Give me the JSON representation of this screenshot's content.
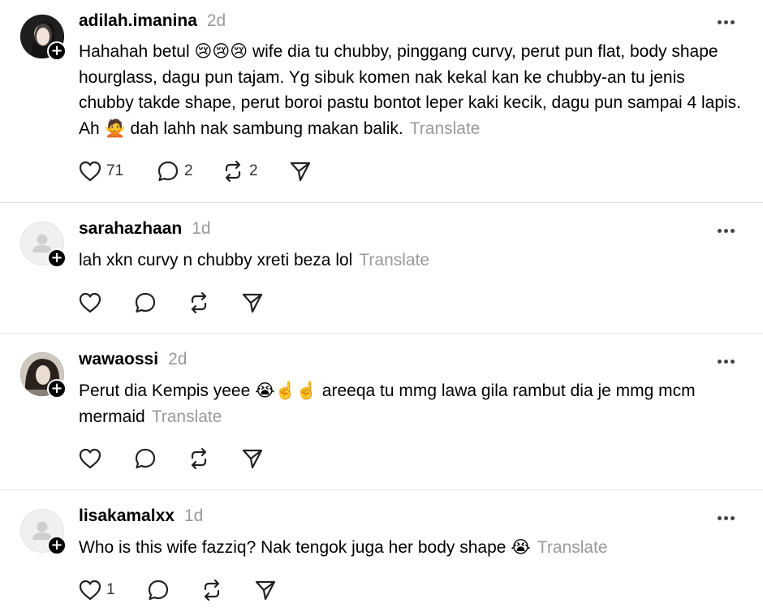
{
  "comments": [
    {
      "username": "adilah.imanina",
      "time": "2d",
      "avatar": "photo",
      "text": "Hahahah betul 😢😢😢 wife dia tu chubby, pinggang curvy, perut pun flat, body shape hourglass, dagu pun tajam. Yg sibuk komen nak kekal kan ke chubby-an tu jenis chubby takde shape, perut boroi pastu bontot leper kaki kecik, dagu pun sampai 4 lapis. Ah 🙅 dah lahh nak sambung makan balik.",
      "translate": "Translate",
      "likes": "71",
      "replies": "2",
      "reposts": "2"
    },
    {
      "username": "sarahazhaan",
      "time": "1d",
      "avatar": "default",
      "text": "lah xkn curvy n chubby xreti beza lol",
      "translate": "Translate",
      "likes": "",
      "replies": "",
      "reposts": ""
    },
    {
      "username": "wawaossi",
      "time": "2d",
      "avatar": "photo",
      "text": "Perut dia Kempis yeee 😭☝️☝️ areeqa tu mmg lawa gila rambut dia je mmg mcm mermaid",
      "translate": "Translate",
      "likes": "",
      "replies": "",
      "reposts": ""
    },
    {
      "username": "lisakamalxx",
      "time": "1d",
      "avatar": "default",
      "text": "Who is this wife fazziq? Nak tengok juga her body shape 😭",
      "translate": "Translate",
      "likes": "1",
      "replies": "",
      "reposts": ""
    }
  ],
  "icons": {
    "like": "heart-icon",
    "reply": "comment-bubble-icon",
    "repost": "repost-icon",
    "share": "send-icon",
    "more": "more-icon",
    "follow": "plus-icon"
  },
  "colors": {
    "text": "#000000",
    "muted": "#999999",
    "divider": "#e2e2e2",
    "badge": "#000000"
  }
}
